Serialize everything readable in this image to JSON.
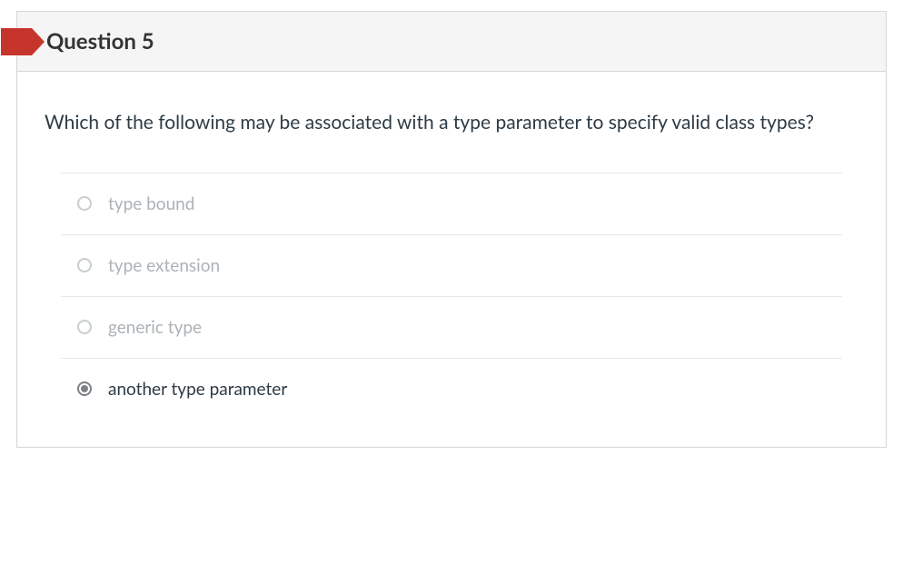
{
  "header": {
    "title": "Question 5"
  },
  "prompt": "Which of the following may be associated with a type parameter to specify valid class types?",
  "answers": [
    {
      "label": "type bound",
      "selected": false
    },
    {
      "label": "type extension",
      "selected": false
    },
    {
      "label": "generic type",
      "selected": false
    },
    {
      "label": "another type parameter",
      "selected": true
    }
  ]
}
